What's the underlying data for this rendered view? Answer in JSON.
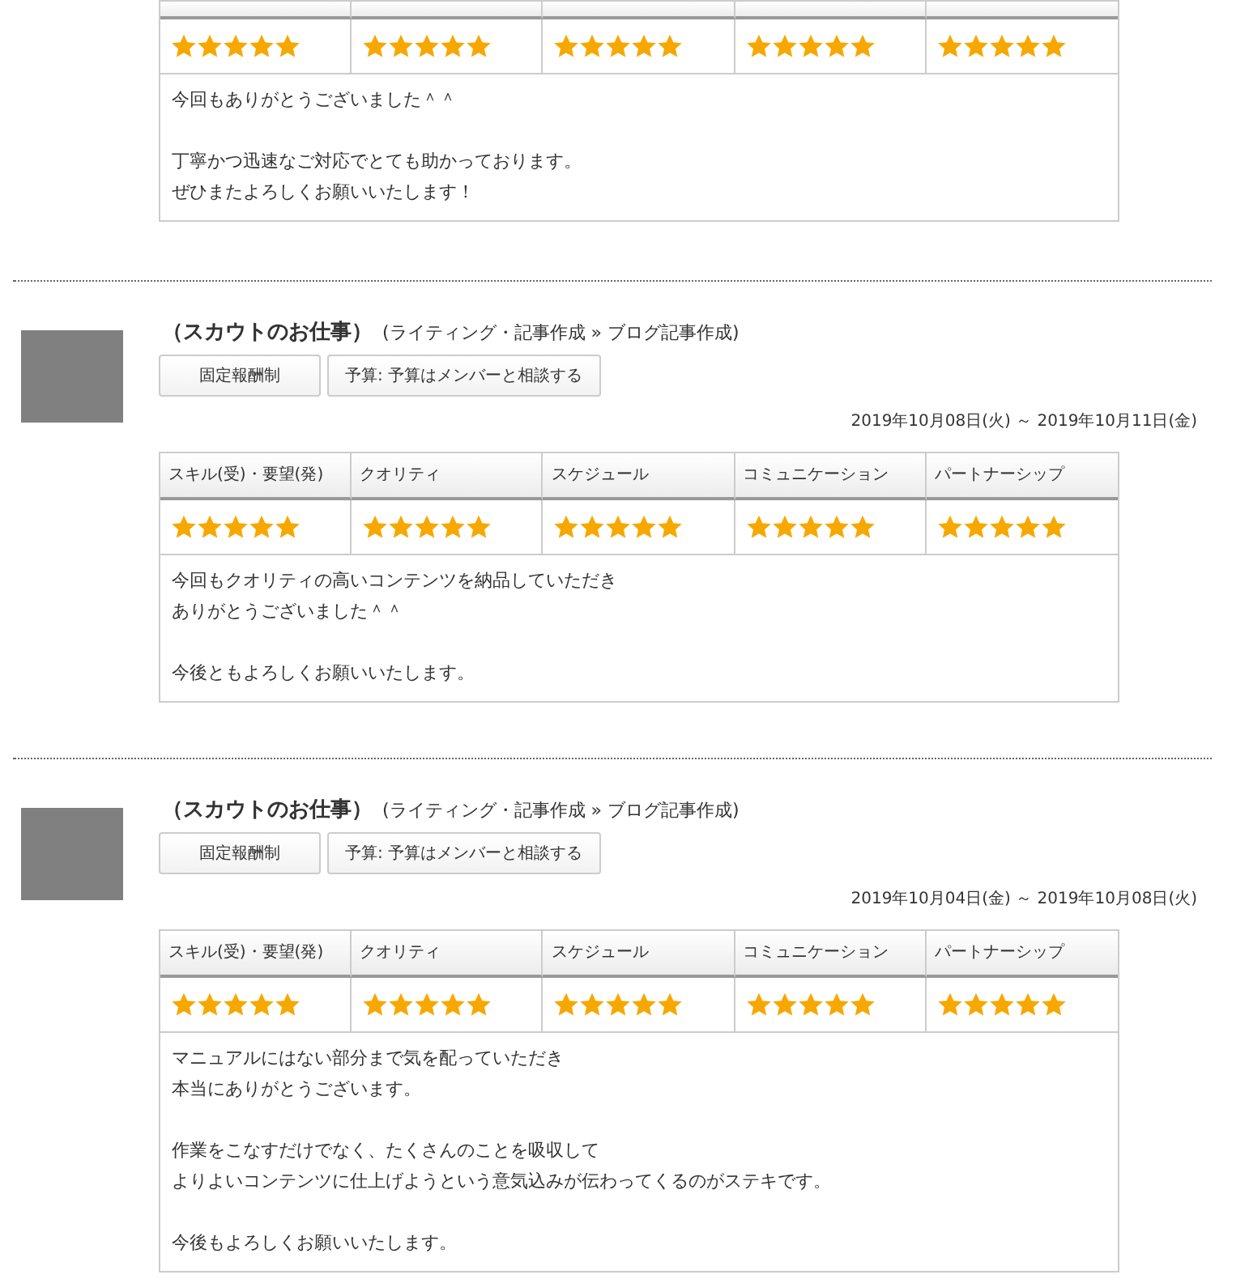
{
  "reviews": [
    {
      "ratings": [
        {
          "stars": 5
        },
        {
          "stars": 5
        },
        {
          "stars": 5
        },
        {
          "stars": 5
        },
        {
          "stars": 5
        }
      ],
      "comment": [
        [
          "今回もありがとうございました＾＾"
        ],
        [
          "丁寧かつ迅速なご対応でとても助かっております。",
          "ぜひまたよろしくお願いいたします！"
        ]
      ]
    },
    {
      "title": "（スカウトのお仕事）",
      "category": "(ライティング・記事作成 » ブログ記事作成)",
      "tags": [
        "固定報酬制",
        "予算: 予算はメンバーと相談する"
      ],
      "period": "2019年10月08日(火) ～ 2019年10月11日(金)",
      "columns": [
        "スキル(受)・要望(発)",
        "クオリティ",
        "スケジュール",
        "コミュニケーション",
        "パートナーシップ"
      ],
      "ratings": [
        {
          "stars": 5
        },
        {
          "stars": 5
        },
        {
          "stars": 5
        },
        {
          "stars": 5
        },
        {
          "stars": 5
        }
      ],
      "comment": [
        [
          "今回もクオリティの高いコンテンツを納品していただき",
          "ありがとうございました＾＾"
        ],
        [
          "今後ともよろしくお願いいたします。"
        ]
      ]
    },
    {
      "title": "（スカウトのお仕事）",
      "category": "(ライティング・記事作成 » ブログ記事作成)",
      "tags": [
        "固定報酬制",
        "予算: 予算はメンバーと相談する"
      ],
      "period": "2019年10月04日(金) ～ 2019年10月08日(火)",
      "columns": [
        "スキル(受)・要望(発)",
        "クオリティ",
        "スケジュール",
        "コミュニケーション",
        "パートナーシップ"
      ],
      "ratings": [
        {
          "stars": 5
        },
        {
          "stars": 5
        },
        {
          "stars": 5
        },
        {
          "stars": 5
        },
        {
          "stars": 5
        }
      ],
      "comment": [
        [
          "マニュアルにはない部分まで気を配っていただき",
          "本当にありがとうございます。"
        ],
        [
          "作業をこなすだけでなく、たくさんのことを吸収して",
          "よりよいコンテンツに仕上げようという意気込みが伝わってくるのがステキです。"
        ],
        [
          "今後もよろしくお願いいたします。"
        ]
      ]
    }
  ]
}
